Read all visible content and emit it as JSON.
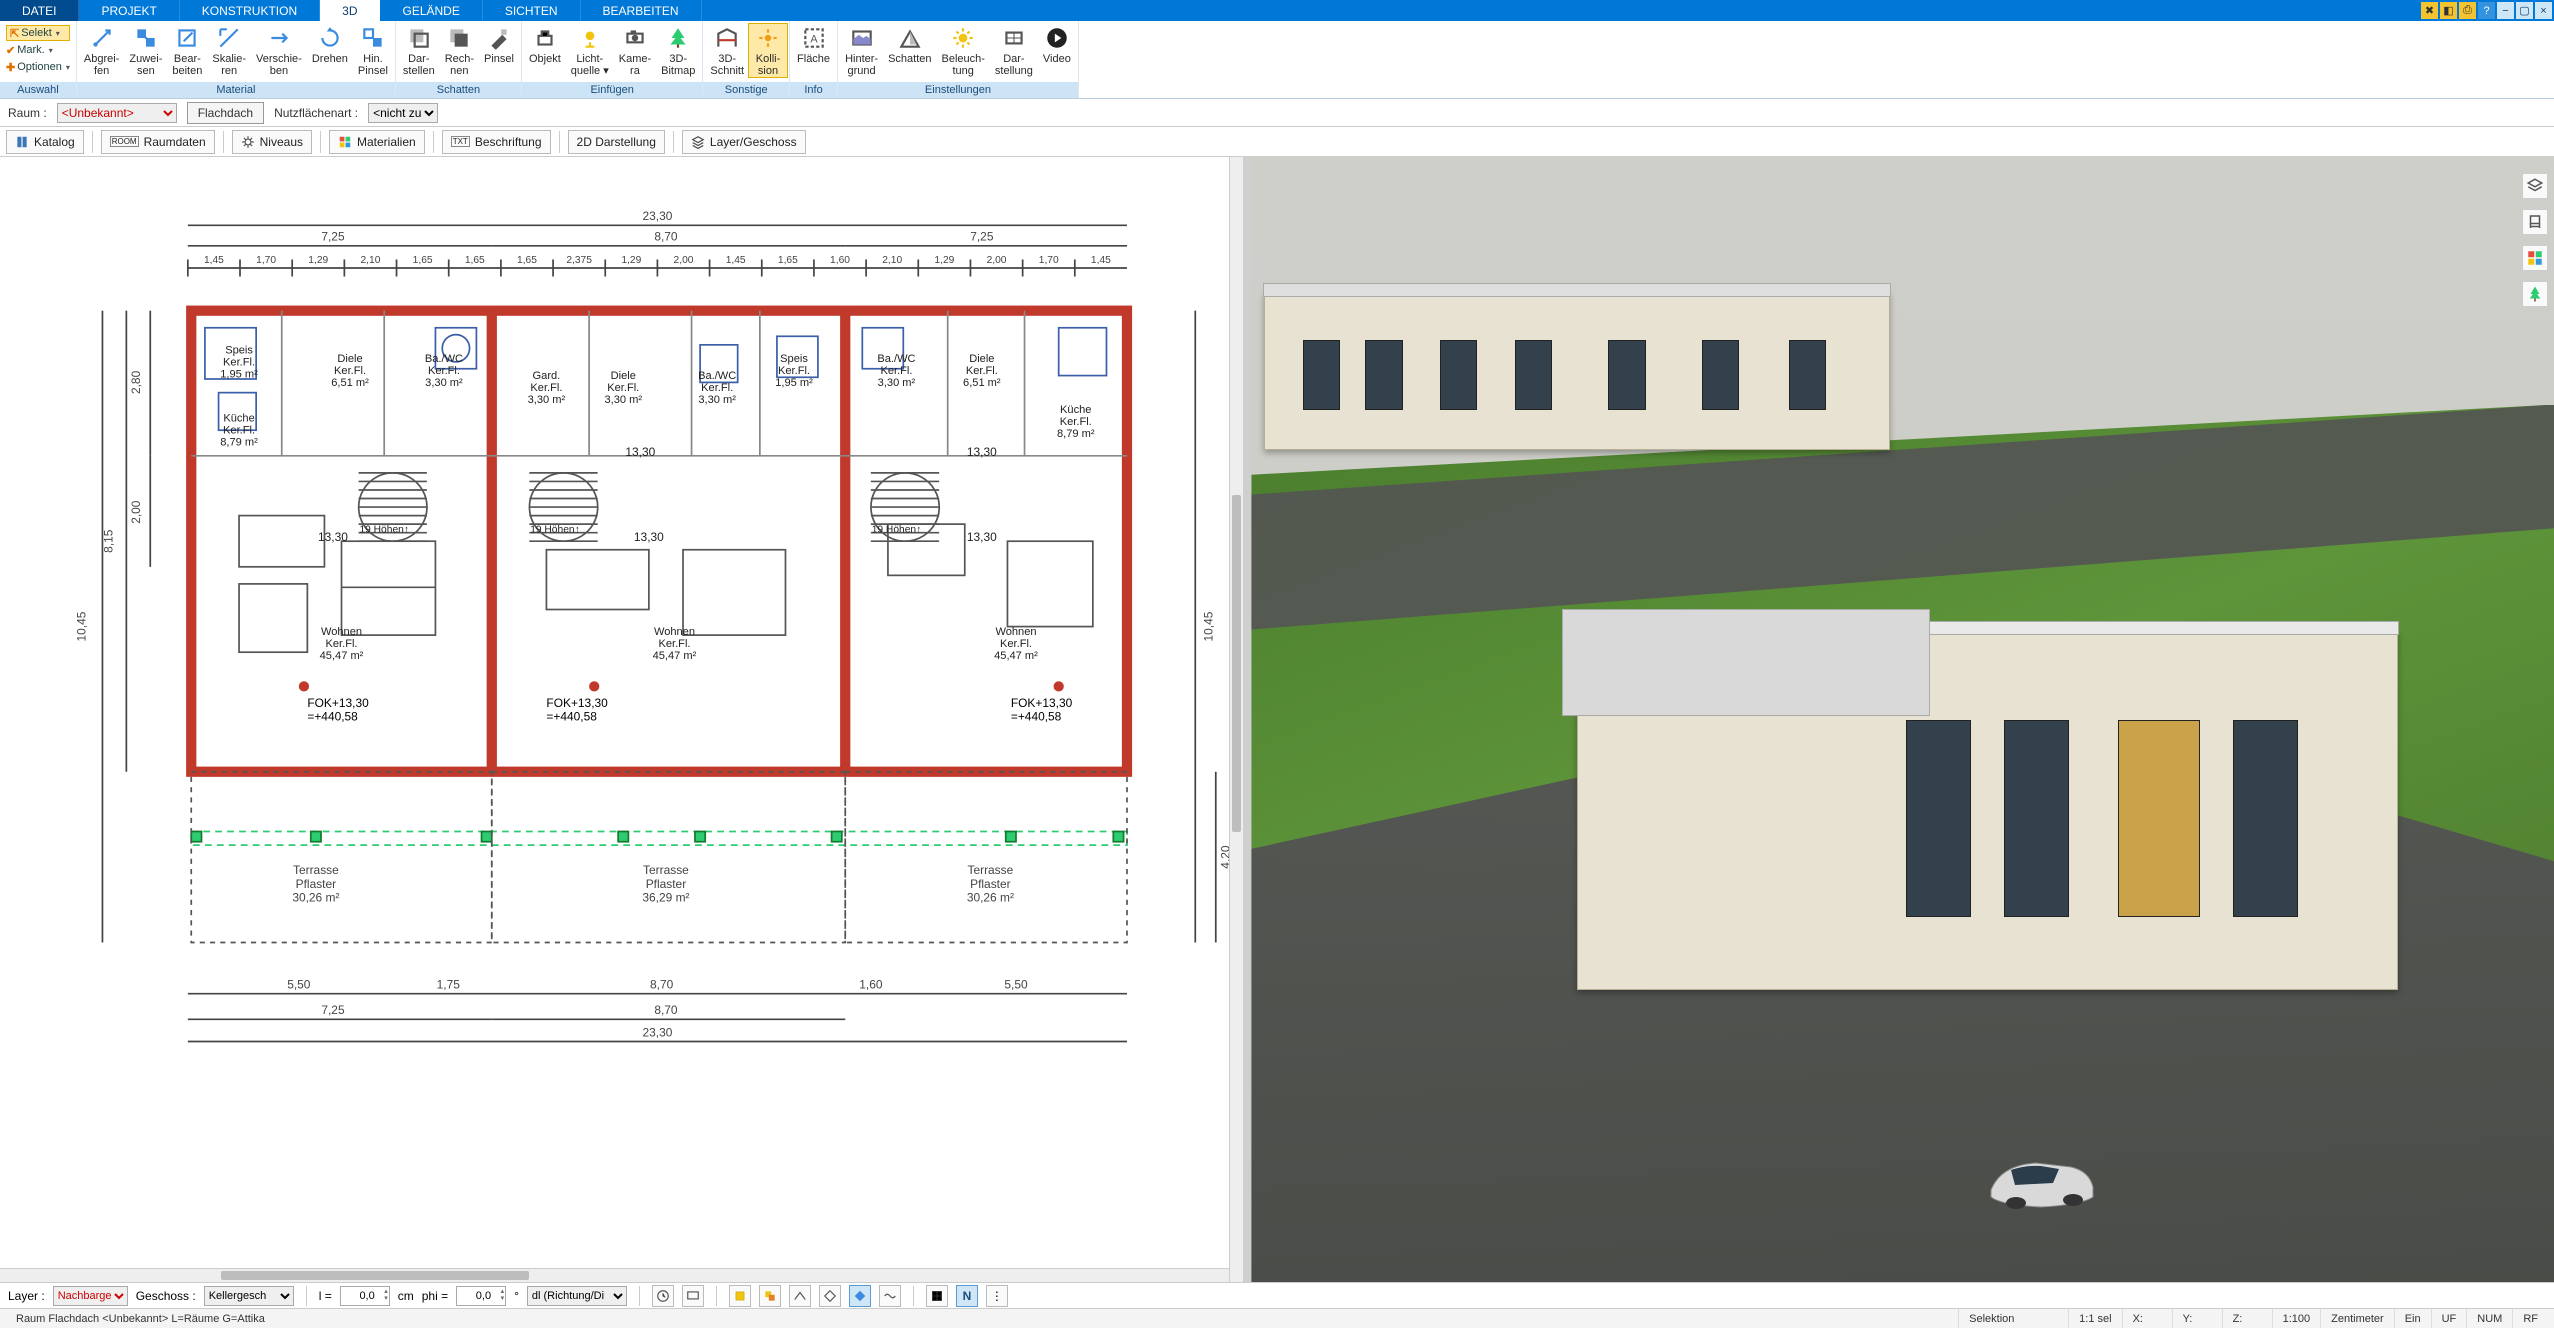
{
  "menu": {
    "tabs": [
      "DATEI",
      "PROJEKT",
      "KONSTRUKTION",
      "3D",
      "GELÄNDE",
      "SICHTEN",
      "BEARBEITEN"
    ],
    "active_index": 3
  },
  "ribbon": {
    "auswahl": {
      "label": "Auswahl",
      "selekt": "Selekt",
      "mark": "Mark.",
      "optionen": "Optionen"
    },
    "groups": [
      {
        "label": "Material",
        "buttons": [
          {
            "l1": "Abgrei-",
            "l2": "fen"
          },
          {
            "l1": "Zuwei-",
            "l2": "sen"
          },
          {
            "l1": "Bear-",
            "l2": "beiten"
          },
          {
            "l1": "Skalie-",
            "l2": "ren"
          },
          {
            "l1": "Verschie-",
            "l2": "ben"
          },
          {
            "l1": "Drehen",
            "l2": ""
          },
          {
            "l1": "Hin.",
            "l2": "Pinsel"
          }
        ]
      },
      {
        "label": "Schatten",
        "buttons": [
          {
            "l1": "Dar-",
            "l2": "stellen"
          },
          {
            "l1": "Rech-",
            "l2": "nen"
          },
          {
            "l1": "Pinsel",
            "l2": ""
          }
        ]
      },
      {
        "label": "Einfügen",
        "buttons": [
          {
            "l1": "Objekt",
            "l2": ""
          },
          {
            "l1": "Licht-",
            "l2": "quelle",
            "drop": true
          },
          {
            "l1": "Kame-",
            "l2": "ra"
          },
          {
            "l1": "3D-",
            "l2": "Bitmap"
          }
        ]
      },
      {
        "label": "Sonstige",
        "buttons": [
          {
            "l1": "3D-",
            "l2": "Schnitt"
          },
          {
            "l1": "Kolli-",
            "l2": "sion",
            "sel": true
          }
        ]
      },
      {
        "label": "Info",
        "buttons": [
          {
            "l1": "Fläche",
            "l2": ""
          }
        ]
      },
      {
        "label": "Einstellungen",
        "buttons": [
          {
            "l1": "Hinter-",
            "l2": "grund"
          },
          {
            "l1": "Schatten",
            "l2": ""
          },
          {
            "l1": "Beleuch-",
            "l2": "tung"
          },
          {
            "l1": "Dar-",
            "l2": "stellung"
          },
          {
            "l1": "Video",
            "l2": ""
          }
        ]
      }
    ]
  },
  "context": {
    "raum_label": "Raum :",
    "raum_value": "<Unbekannt>",
    "flachdach": "Flachdach",
    "nutz_label": "Nutzflächenart :",
    "nutz_value": "<nicht zug"
  },
  "toolbar2": {
    "katalog": "Katalog",
    "raumdaten": "Raumdaten",
    "niveaus": "Niveaus",
    "materialien": "Materialien",
    "beschriftung": "Beschriftung",
    "txt_badge": "TXT",
    "darstellung": "2D Darstellung",
    "layer": "Layer/Geschoss"
  },
  "plan": {
    "overall_w": "23,30",
    "left_w": "7,25",
    "right_w": "8,70",
    "span_right": "7,25",
    "inner_dims": [
      "1,45",
      "1,70",
      "1,29",
      "2,10",
      "1,65",
      "1,65",
      "1,65",
      "2,375",
      "1,29",
      "2,00",
      "1,45",
      "1,65",
      "1,60",
      "2,10",
      "1,29",
      "2,00",
      "1,70",
      "1,45"
    ],
    "h_left": "10,45",
    "h_mid": "8,15",
    "row1": "2,80",
    "row2": "2,00",
    "terr_h": "4,20",
    "rooms": [
      {
        "name": "Speis",
        "sub": "Ker.Fl.",
        "area": "1,95 m²"
      },
      {
        "name": "Diele",
        "sub": "Ker.Fl.",
        "area": "6,51 m²"
      },
      {
        "name": "Ba./WC",
        "sub": "Ker.Fl.",
        "area": "3,30 m²"
      },
      {
        "name": "Küche",
        "sub": "Ker.Fl.",
        "area": "8,79 m²"
      },
      {
        "name": "Gard.",
        "sub": "Ker.Fl.",
        "area": "3,30 m²"
      },
      {
        "name": "Diele",
        "sub": "Ker.Fl.",
        "area": "3,30 m²"
      },
      {
        "name": "Ba./WC",
        "sub": "Ker.Fl.",
        "area": "3,30 m²"
      },
      {
        "name": "Speis",
        "sub": "Ker.Fl.",
        "area": "1,95 m²"
      },
      {
        "name": "Ba./WC",
        "sub": "Ker.Fl.",
        "area": "3,30 m²"
      },
      {
        "name": "Diele",
        "sub": "Ker.Fl.",
        "area": "6,51 m²"
      },
      {
        "name": "Küche",
        "sub": "Ker.Fl.",
        "area": "8,79 m²"
      }
    ],
    "wohnen": {
      "name": "Wohnen",
      "sub": "Ker.Fl.",
      "area": "45,47 m²"
    },
    "stair_label": "19 Höhen↑",
    "fok": [
      {
        "t1": "FOK+13,30",
        "t2": "=+440,58"
      },
      {
        "t1": "FOK+13,30",
        "t2": "=+440,58"
      },
      {
        "t1": "FOK+13,30",
        "t2": "=+440,58"
      }
    ],
    "rd_marks": [
      "13,30",
      "13,30",
      "13,30",
      "13,30",
      "13,30"
    ],
    "terrasse": [
      {
        "name": "Terrasse",
        "sub": "Pflaster",
        "area": "30,26 m²"
      },
      {
        "name": "Terrasse",
        "sub": "Pflaster",
        "area": "36,29 m²"
      },
      {
        "name": "Terrasse",
        "sub": "Pflaster",
        "area": "30,26 m²"
      }
    ],
    "bot_dims": [
      "5,50",
      "1,75",
      "8,70",
      "1,60",
      "5,50"
    ]
  },
  "coord": {
    "layer_label": "Layer :",
    "layer_value": "Nachbarge",
    "geschoss_label": "Geschoss :",
    "geschoss_value": "Kellergesch",
    "l_label": "l =",
    "l_value": "0,0",
    "l_unit": "cm",
    "phi_label": "phi =",
    "phi_value": "0,0",
    "phi_unit": "°",
    "dl_value": "dl (Richtung/Di"
  },
  "status": {
    "left": "Raum Flachdach <Unbekannt>  L=Räume G=Attika",
    "selektion": "Selektion",
    "sel_ratio": "1:1 sel",
    "x": "X:",
    "y": "Y:",
    "z": "Z:",
    "scale": "1:100",
    "unit": "Zentimeter",
    "ein": "Ein",
    "uf": "UF",
    "num": "NUM",
    "rf": "RF"
  },
  "colors": {
    "accent": "#0078d7",
    "highlight": "#ffe9a8"
  }
}
